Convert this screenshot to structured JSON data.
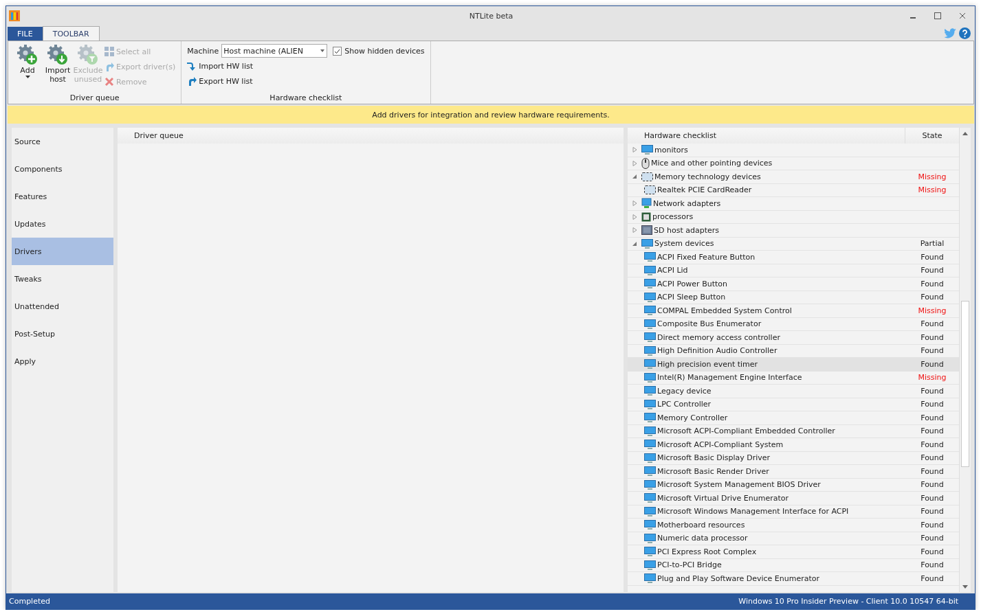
{
  "window": {
    "title": "NTLite beta"
  },
  "ribbon_tabs": [
    {
      "label": "FILE",
      "kind": "file",
      "selected": false
    },
    {
      "label": "TOOLBAR",
      "kind": "tab",
      "selected": true
    }
  ],
  "driver_queue_group": {
    "label": "Driver queue",
    "big_buttons": [
      {
        "label": "Add",
        "kind": "add",
        "disabled": false,
        "dropdown": true
      },
      {
        "label": "Import host",
        "kind": "import",
        "disabled": false,
        "dropdown": false
      },
      {
        "label": "Exclude unused",
        "kind": "exclude",
        "disabled": true,
        "dropdown": false
      }
    ],
    "small_buttons": [
      {
        "label": "Select all",
        "kind": "grid",
        "disabled": true
      },
      {
        "label": "Export driver(s)",
        "kind": "export",
        "disabled": true
      },
      {
        "label": "Remove",
        "kind": "remove",
        "disabled": true
      }
    ]
  },
  "hardware_group": {
    "label": "Hardware checklist",
    "machine_label": "Machine",
    "machine_value": "Host machine (ALIEN",
    "show_hidden": {
      "label": "Show hidden devices",
      "checked": true
    },
    "buttons": [
      {
        "label": "Import HW list",
        "kind": "import"
      },
      {
        "label": "Export HW list",
        "kind": "export"
      }
    ]
  },
  "banner": "Add drivers for integration and review hardware requirements.",
  "sidebar": {
    "items": [
      {
        "label": "Source",
        "selected": false
      },
      {
        "label": "Components",
        "selected": false
      },
      {
        "label": "Features",
        "selected": false
      },
      {
        "label": "Updates",
        "selected": false
      },
      {
        "label": "Drivers",
        "selected": true
      },
      {
        "label": "Tweaks",
        "selected": false
      },
      {
        "label": "Unattended",
        "selected": false
      },
      {
        "label": "Post-Setup",
        "selected": false
      },
      {
        "label": "Apply",
        "selected": false
      }
    ]
  },
  "driver_queue": {
    "header": "Driver queue"
  },
  "hardware_checklist": {
    "columns": [
      "Hardware checklist",
      "State"
    ],
    "rows": [
      {
        "name": "monitors",
        "kind": "monitor",
        "expanded": false,
        "selected": false
      },
      {
        "name": "Mice and other pointing devices",
        "kind": "mouse",
        "expanded": false,
        "selected": false
      },
      {
        "name": "Memory technology devices",
        "kind": "card",
        "expanded": true,
        "state": "Missing",
        "alert": true,
        "selected": false,
        "children": [
          {
            "name": "Realtek PCIE CardReader",
            "kind": "card",
            "state": "Missing",
            "alert": true,
            "selected": false
          }
        ]
      },
      {
        "name": "Network adapters",
        "kind": "network",
        "expanded": false,
        "selected": false
      },
      {
        "name": "processors",
        "kind": "chip",
        "expanded": false,
        "selected": false
      },
      {
        "name": "SD host adapters",
        "kind": "sd",
        "expanded": false,
        "selected": false
      },
      {
        "name": "System devices",
        "kind": "monitor",
        "expanded": true,
        "state": "Partial",
        "alert": false,
        "selected": false,
        "children": [
          {
            "name": "ACPI Fixed Feature Button",
            "kind": "monitor",
            "state": "Found",
            "alert": false,
            "selected": false
          },
          {
            "name": "ACPI Lid",
            "kind": "monitor",
            "state": "Found",
            "alert": false,
            "selected": false
          },
          {
            "name": "ACPI Power Button",
            "kind": "monitor",
            "state": "Found",
            "alert": false,
            "selected": false
          },
          {
            "name": "ACPI Sleep Button",
            "kind": "monitor",
            "state": "Found",
            "alert": false,
            "selected": false
          },
          {
            "name": "COMPAL Embedded System Control",
            "kind": "monitor",
            "state": "Missing",
            "alert": true,
            "selected": false
          },
          {
            "name": "Composite Bus Enumerator",
            "kind": "monitor",
            "state": "Found",
            "alert": false,
            "selected": false
          },
          {
            "name": "Direct memory access controller",
            "kind": "monitor",
            "state": "Found",
            "alert": false,
            "selected": false
          },
          {
            "name": "High Definition Audio Controller",
            "kind": "monitor",
            "state": "Found",
            "alert": false,
            "selected": false
          },
          {
            "name": "High precision event timer",
            "kind": "monitor",
            "state": "Found",
            "alert": false,
            "selected": true
          },
          {
            "name": "Intel(R) Management Engine Interface",
            "kind": "monitor",
            "state": "Missing",
            "alert": true,
            "selected": false
          },
          {
            "name": "Legacy device",
            "kind": "monitor",
            "state": "Found",
            "alert": false,
            "selected": false
          },
          {
            "name": "LPC Controller",
            "kind": "monitor",
            "state": "Found",
            "alert": false,
            "selected": false
          },
          {
            "name": "Memory Controller",
            "kind": "monitor",
            "state": "Found",
            "alert": false,
            "selected": false
          },
          {
            "name": "Microsoft ACPI-Compliant Embedded Controller",
            "kind": "monitor",
            "state": "Found",
            "alert": false,
            "selected": false
          },
          {
            "name": "Microsoft ACPI-Compliant System",
            "kind": "monitor",
            "state": "Found",
            "alert": false,
            "selected": false
          },
          {
            "name": "Microsoft Basic Display Driver",
            "kind": "monitor",
            "state": "Found",
            "alert": false,
            "selected": false
          },
          {
            "name": "Microsoft Basic Render Driver",
            "kind": "monitor",
            "state": "Found",
            "alert": false,
            "selected": false
          },
          {
            "name": "Microsoft System Management BIOS Driver",
            "kind": "monitor",
            "state": "Found",
            "alert": false,
            "selected": false
          },
          {
            "name": "Microsoft Virtual Drive Enumerator",
            "kind": "monitor",
            "state": "Found",
            "alert": false,
            "selected": false
          },
          {
            "name": "Microsoft Windows Management Interface for ACPI",
            "kind": "monitor",
            "state": "Found",
            "alert": false,
            "selected": false
          },
          {
            "name": "Motherboard resources",
            "kind": "monitor",
            "state": "Found",
            "alert": false,
            "selected": false
          },
          {
            "name": "Numeric data processor",
            "kind": "monitor",
            "state": "Found",
            "alert": false,
            "selected": false
          },
          {
            "name": "PCI Express Root Complex",
            "kind": "monitor",
            "state": "Found",
            "alert": false,
            "selected": false
          },
          {
            "name": "PCI-to-PCI Bridge",
            "kind": "monitor",
            "state": "Found",
            "alert": false,
            "selected": false
          },
          {
            "name": "Plug and Play Software Device Enumerator",
            "kind": "monitor",
            "state": "Found",
            "alert": false,
            "selected": false
          }
        ]
      }
    ]
  },
  "status_bar": {
    "left": "Completed",
    "right": "Windows 10 Pro Insider Preview - Client 10.0 10547 64-bit"
  }
}
